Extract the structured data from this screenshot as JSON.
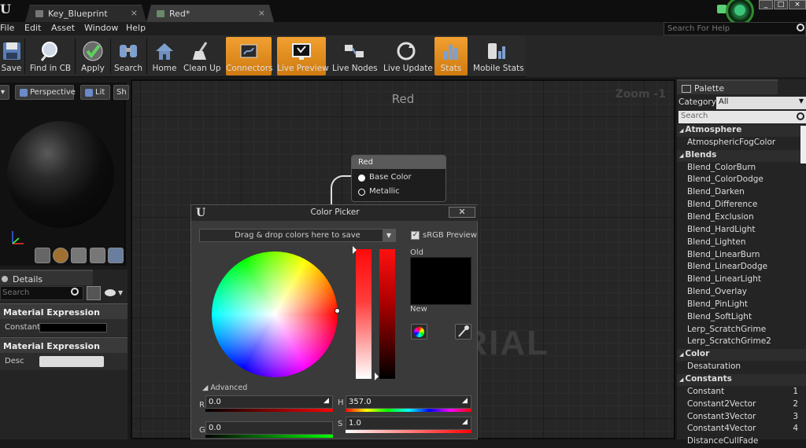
{
  "tabs": [
    {
      "label": "Key_Blueprint",
      "close": "×"
    },
    {
      "label": "Red*",
      "close": "×"
    }
  ],
  "window_controls": [
    "_",
    "□",
    "×"
  ],
  "menu": [
    "File",
    "Edit",
    "Asset",
    "Window",
    "Help"
  ],
  "help_search_placeholder": "Search For Help",
  "toolbar": [
    {
      "label": "Save",
      "icon": "save-icon",
      "active": false
    },
    {
      "label": "Find in CB",
      "icon": "magnifier-icon",
      "active": false
    },
    {
      "label": "Apply",
      "icon": "checkmark-icon",
      "active": false
    },
    {
      "label": "Search",
      "icon": "binoculars-icon",
      "active": false
    },
    {
      "label": "Home",
      "icon": "home-icon",
      "active": false
    },
    {
      "label": "Clean Up",
      "icon": "broom-icon",
      "active": false
    },
    {
      "label": "Connectors",
      "icon": "connectors-icon",
      "active": true
    },
    {
      "label": "Live Preview",
      "icon": "tv-icon",
      "active": true
    },
    {
      "label": "Live Nodes",
      "icon": "nodes-icon",
      "active": false
    },
    {
      "label": "Live Update",
      "icon": "refresh-icon",
      "active": false
    },
    {
      "label": "Stats",
      "icon": "stats-icon",
      "active": true
    },
    {
      "label": "Mobile Stats",
      "icon": "mobile-stats-icon",
      "active": false
    }
  ],
  "viewport": {
    "perspective": "Perspective",
    "lit": "Lit",
    "show": "Sh"
  },
  "details": {
    "tab_label": "Details",
    "search_placeholder": "Search",
    "sections": [
      {
        "title": "Material Expression Constant",
        "row_key": "Constant"
      },
      {
        "title": "Material Expression",
        "row_key": "Desc"
      }
    ]
  },
  "graph": {
    "title": "Red",
    "zoom": "Zoom -1",
    "watermark": "MATERIAL",
    "node": {
      "title": "Red",
      "pins": [
        "Base Color",
        "Metallic"
      ]
    }
  },
  "color_picker": {
    "title": "Color Picker",
    "close": "✕",
    "drag_drop": "Drag & drop colors here to save",
    "srgb_label": "sRGB Preview",
    "old_label": "Old",
    "new_label": "New",
    "advanced_label": "Advanced",
    "fields": {
      "r": {
        "key": "R",
        "value": "0.0"
      },
      "g": {
        "key": "G",
        "value": "0.0"
      },
      "h": {
        "key": "H",
        "value": "357.0"
      },
      "s": {
        "key": "S",
        "value": "1.0"
      }
    }
  },
  "palette": {
    "tab_label": "Palette",
    "category_label": "Category:",
    "category_value": "All",
    "search_placeholder": "Search",
    "rows": [
      {
        "type": "cat",
        "label": "Atmosphere"
      },
      {
        "type": "item",
        "label": "AtmosphericFogColor"
      },
      {
        "type": "cat",
        "label": "Blends"
      },
      {
        "type": "item",
        "label": "Blend_ColorBurn"
      },
      {
        "type": "item",
        "label": "Blend_ColorDodge"
      },
      {
        "type": "item",
        "label": "Blend_Darken"
      },
      {
        "type": "item",
        "label": "Blend_Difference"
      },
      {
        "type": "item",
        "label": "Blend_Exclusion"
      },
      {
        "type": "item",
        "label": "Blend_HardLight"
      },
      {
        "type": "item",
        "label": "Blend_Lighten"
      },
      {
        "type": "item",
        "label": "Blend_LinearBurn"
      },
      {
        "type": "item",
        "label": "Blend_LinearDodge"
      },
      {
        "type": "item",
        "label": "Blend_LinearLight"
      },
      {
        "type": "item",
        "label": "Blend_Overlay"
      },
      {
        "type": "item",
        "label": "Blend_PinLight"
      },
      {
        "type": "item",
        "label": "Blend_SoftLight"
      },
      {
        "type": "item",
        "label": "Lerp_ScratchGrime"
      },
      {
        "type": "item",
        "label": "Lerp_ScratchGrime2"
      },
      {
        "type": "cat",
        "label": "Color"
      },
      {
        "type": "item",
        "label": "Desaturation"
      },
      {
        "type": "cat",
        "label": "Constants"
      },
      {
        "type": "item",
        "label": "Constant",
        "hotkey": "1"
      },
      {
        "type": "item",
        "label": "Constant2Vector",
        "hotkey": "2"
      },
      {
        "type": "item",
        "label": "Constant3Vector",
        "hotkey": "3"
      },
      {
        "type": "item",
        "label": "Constant4Vector",
        "hotkey": "4"
      },
      {
        "type": "item",
        "label": "DistanceCullFade"
      }
    ]
  },
  "colors": {
    "accent_orange": "#e08a1e",
    "panel": "#242424",
    "graph_bg": "#262626"
  }
}
